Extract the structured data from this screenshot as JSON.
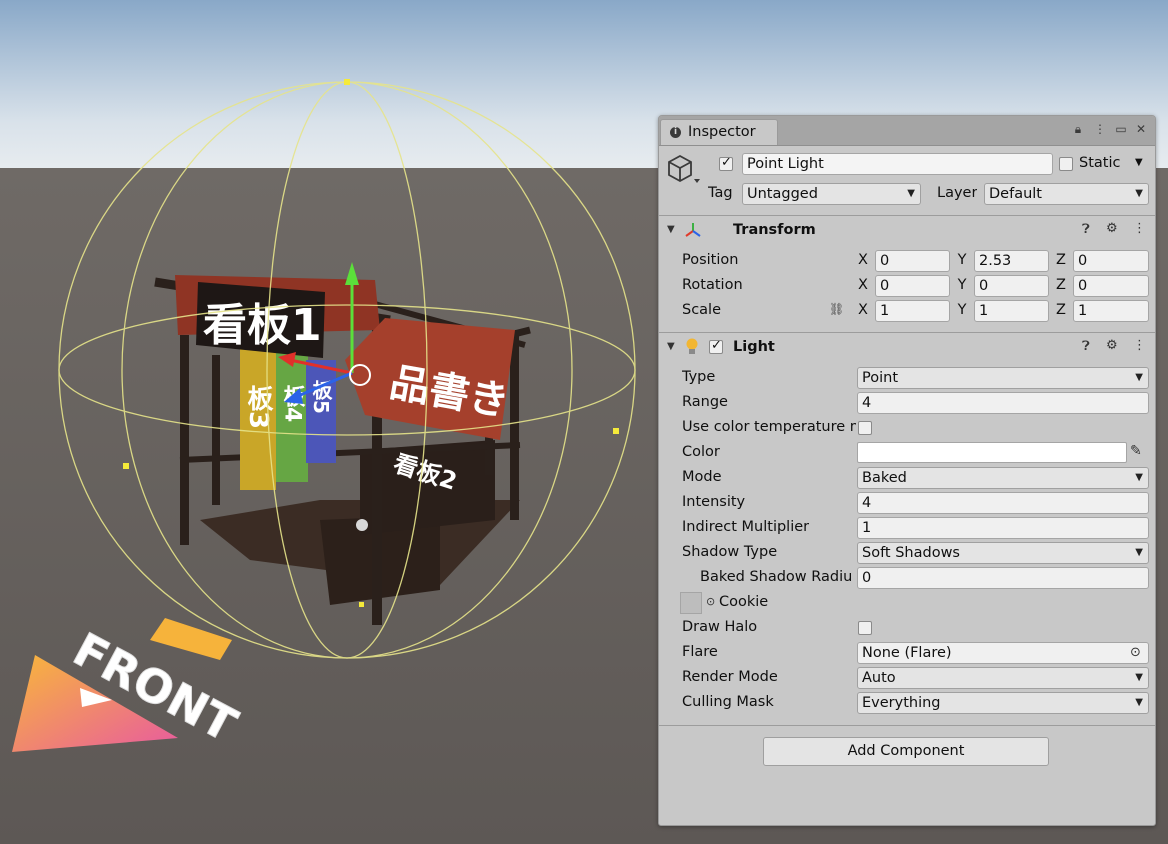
{
  "inspector": {
    "tab_label": "Inspector",
    "object": {
      "active": true,
      "name": "Point Light",
      "static_label": "Static",
      "static_checked": false,
      "tag_label": "Tag",
      "tag_value": "Untagged",
      "layer_label": "Layer",
      "layer_value": "Default"
    },
    "transform": {
      "title": "Transform",
      "position": {
        "label": "Position",
        "x": "0",
        "y": "2.53",
        "z": "0"
      },
      "rotation": {
        "label": "Rotation",
        "x": "0",
        "y": "0",
        "z": "0"
      },
      "scale": {
        "label": "Scale",
        "x": "1",
        "y": "1",
        "z": "1"
      },
      "axis_x": "X",
      "axis_y": "Y",
      "axis_z": "Z"
    },
    "light": {
      "title": "Light",
      "enabled": true,
      "type": {
        "label": "Type",
        "value": "Point"
      },
      "range": {
        "label": "Range",
        "value": "4"
      },
      "use_color_temperature": {
        "label": "Use color temperature m",
        "checked": false
      },
      "color": {
        "label": "Color",
        "value": "#ffffff"
      },
      "mode": {
        "label": "Mode",
        "value": "Baked"
      },
      "intensity": {
        "label": "Intensity",
        "value": "4"
      },
      "indirect_multiplier": {
        "label": "Indirect Multiplier",
        "value": "1"
      },
      "shadow_type": {
        "label": "Shadow Type",
        "value": "Soft Shadows"
      },
      "baked_shadow_radius": {
        "label": "Baked Shadow Radiu",
        "value": "0"
      },
      "cookie": {
        "label": "Cookie"
      },
      "draw_halo": {
        "label": "Draw Halo",
        "checked": false
      },
      "flare": {
        "label": "Flare",
        "value": "None (Flare)"
      },
      "render_mode": {
        "label": "Render Mode",
        "value": "Auto"
      },
      "culling_mask": {
        "label": "Culling Mask",
        "value": "Everything"
      }
    },
    "add_component_label": "Add Component"
  },
  "scene": {
    "sign1": "看板1",
    "sign2": "看板2",
    "sign3": "板3",
    "sign4": "板4",
    "sign5": "板5",
    "banner": "品書き",
    "front_label": "FRONT"
  }
}
